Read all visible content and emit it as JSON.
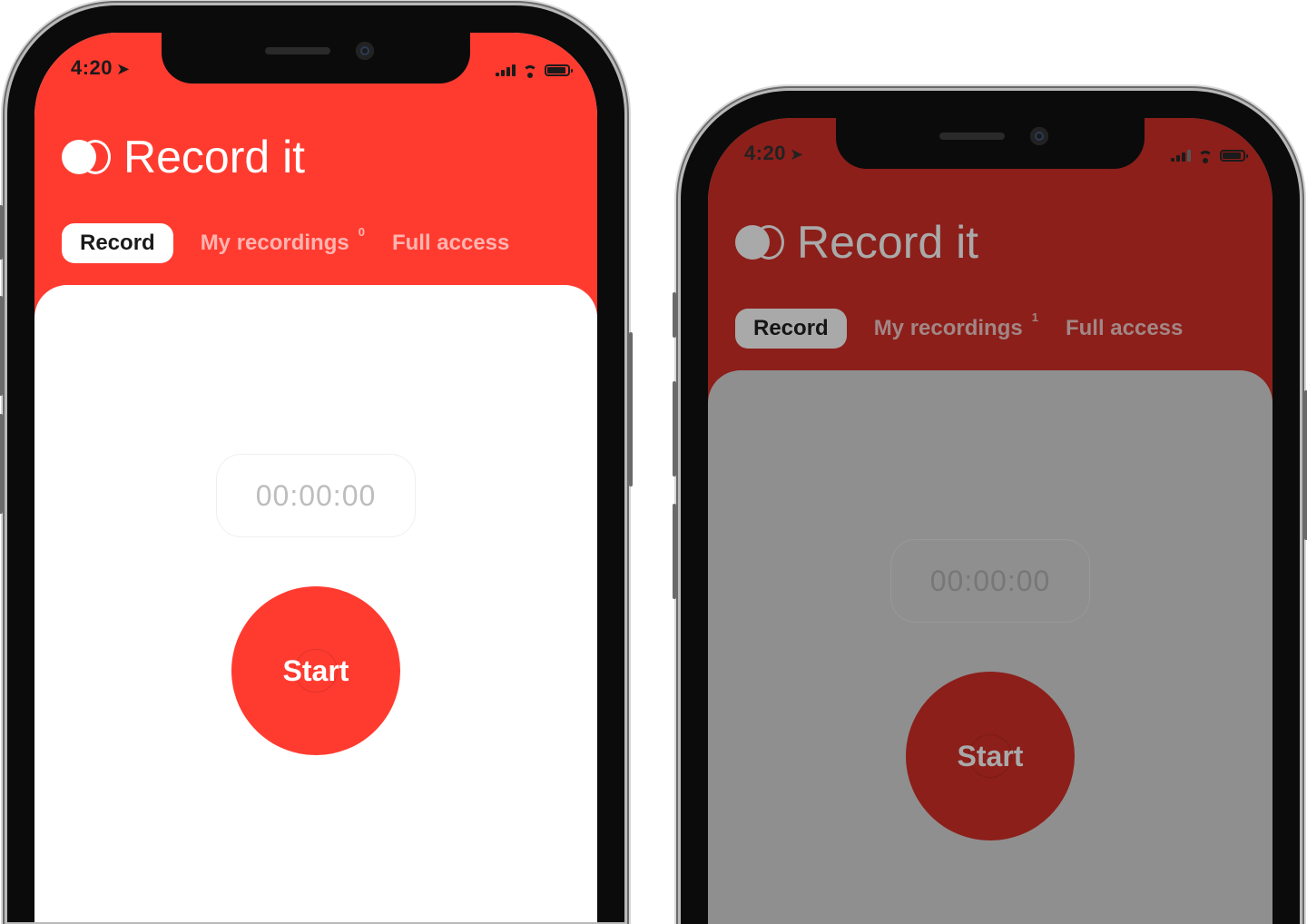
{
  "colors": {
    "accent": "#ff3b30",
    "accent_dimmed": "#8c1f1a",
    "content_bg": "#ffffff",
    "content_bg_dimmed": "#8f8f8f"
  },
  "phones": [
    {
      "status_time": "4:20",
      "app_title": "Record it",
      "tabs": {
        "record": "Record",
        "my_recordings": "My recordings",
        "my_recordings_count": "0",
        "full_access": "Full access"
      },
      "timer": "00:00:00",
      "start_label": "Start",
      "dimmed": false
    },
    {
      "status_time": "4:20",
      "app_title": "Record it",
      "tabs": {
        "record": "Record",
        "my_recordings": "My recordings",
        "my_recordings_count": "1",
        "full_access": "Full access"
      },
      "timer": "00:00:00",
      "start_label": "Start",
      "dimmed": true
    }
  ],
  "icons": [
    "location-arrow-icon",
    "cellular-signal-icon",
    "wifi-icon",
    "battery-icon",
    "app-logo-icon"
  ]
}
